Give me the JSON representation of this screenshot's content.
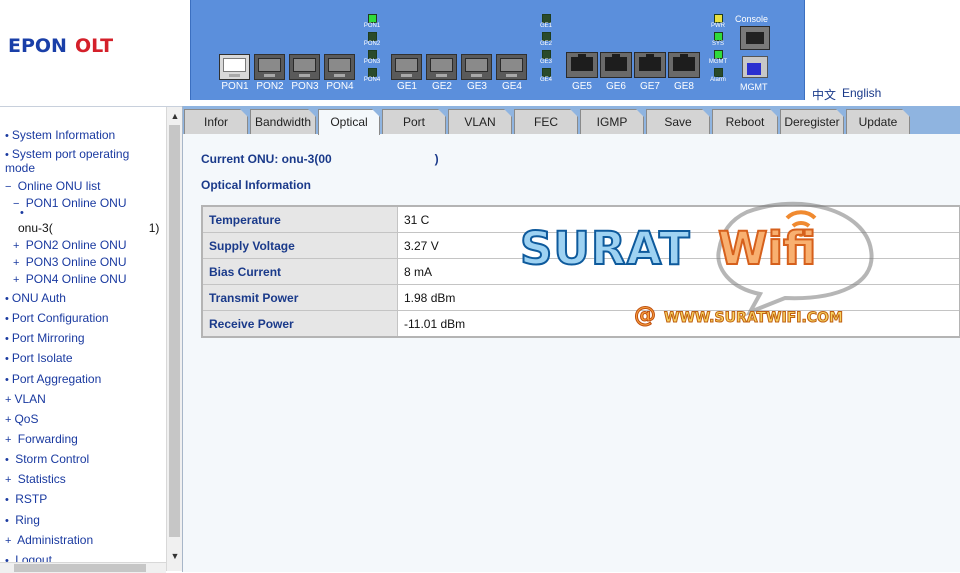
{
  "logo": {
    "epon": "EPON",
    "olt": "OLT"
  },
  "device_panel": {
    "pon_ports": [
      "PON1",
      "PON2",
      "PON3",
      "PON4"
    ],
    "ge_sfp_ports": [
      "GE1",
      "GE2",
      "GE3",
      "GE4"
    ],
    "ge_rj45_ports": [
      "GE5",
      "GE6",
      "GE7",
      "GE8"
    ],
    "pon_leds": [
      "PON1",
      "PON2",
      "PON3",
      "PON4"
    ],
    "ge_leds": [
      "GE1",
      "GE2",
      "GE3",
      "GE4"
    ],
    "sys_leds": [
      "PWR",
      "SYS",
      "MGMT",
      "Alarm"
    ],
    "console_label": "Console",
    "mgmt_label": "MGMT"
  },
  "language": {
    "zh": "中文",
    "en": "English"
  },
  "sidebar": {
    "items": [
      {
        "bullet": "•",
        "label": "System Information"
      },
      {
        "bullet": "•",
        "label": "System port operating"
      },
      {
        "bullet": "",
        "label": "mode"
      },
      {
        "bullet": "−",
        "label": "Online ONU list"
      },
      {
        "bullet": "−",
        "label": "PON1 Online ONU"
      },
      {
        "bullet": "•",
        "label": ""
      },
      {
        "bullet": "",
        "label": "onu-3("
      },
      {
        "bullet": "+",
        "label": "PON2 Online ONU"
      },
      {
        "bullet": "+",
        "label": "PON3 Online ONU"
      },
      {
        "bullet": "+",
        "label": "PON4 Online ONU"
      },
      {
        "bullet": "•",
        "label": "ONU Auth"
      },
      {
        "bullet": "•",
        "label": "Port Configuration"
      },
      {
        "bullet": "•",
        "label": "Port Mirroring"
      },
      {
        "bullet": "•",
        "label": "Port Isolate"
      },
      {
        "bullet": "•",
        "label": "Port Aggregation"
      },
      {
        "bullet": "+",
        "label": "VLAN"
      },
      {
        "bullet": "+",
        "label": "QoS"
      },
      {
        "bullet": "+",
        "label": "Forwarding"
      },
      {
        "bullet": "•",
        "label": "Storm Control"
      },
      {
        "bullet": "+",
        "label": "Statistics"
      },
      {
        "bullet": "•",
        "label": "RSTP"
      },
      {
        "bullet": "•",
        "label": "Ring"
      },
      {
        "bullet": "+",
        "label": "Administration"
      },
      {
        "bullet": "•",
        "label": "Logout"
      }
    ],
    "truncated_suffix": "1)"
  },
  "tabs": [
    "Infor",
    "Bandwidth",
    "Optical",
    "Port",
    "VLAN",
    "FEC",
    "IGMP",
    "Save",
    "Reboot",
    "Deregister",
    "Update"
  ],
  "active_tab": "Optical",
  "main": {
    "current_onu_label": "Current ONU: onu-3(00",
    "current_onu_close": ")",
    "section_title": "Optical Information",
    "rows": [
      {
        "label": "Temperature",
        "value": "31 C"
      },
      {
        "label": "Supply Voltage",
        "value": "3.27 V"
      },
      {
        "label": "Bias Current",
        "value": "8 mA"
      },
      {
        "label": "Transmit Power",
        "value": "1.98 dBm"
      },
      {
        "label": "Receive Power",
        "value": "-11.01 dBm"
      }
    ]
  },
  "watermark": {
    "word1": "SURAT",
    "word2": "Wifi",
    "at": "@",
    "url": "WWW.SURATWIFI.COM"
  }
}
